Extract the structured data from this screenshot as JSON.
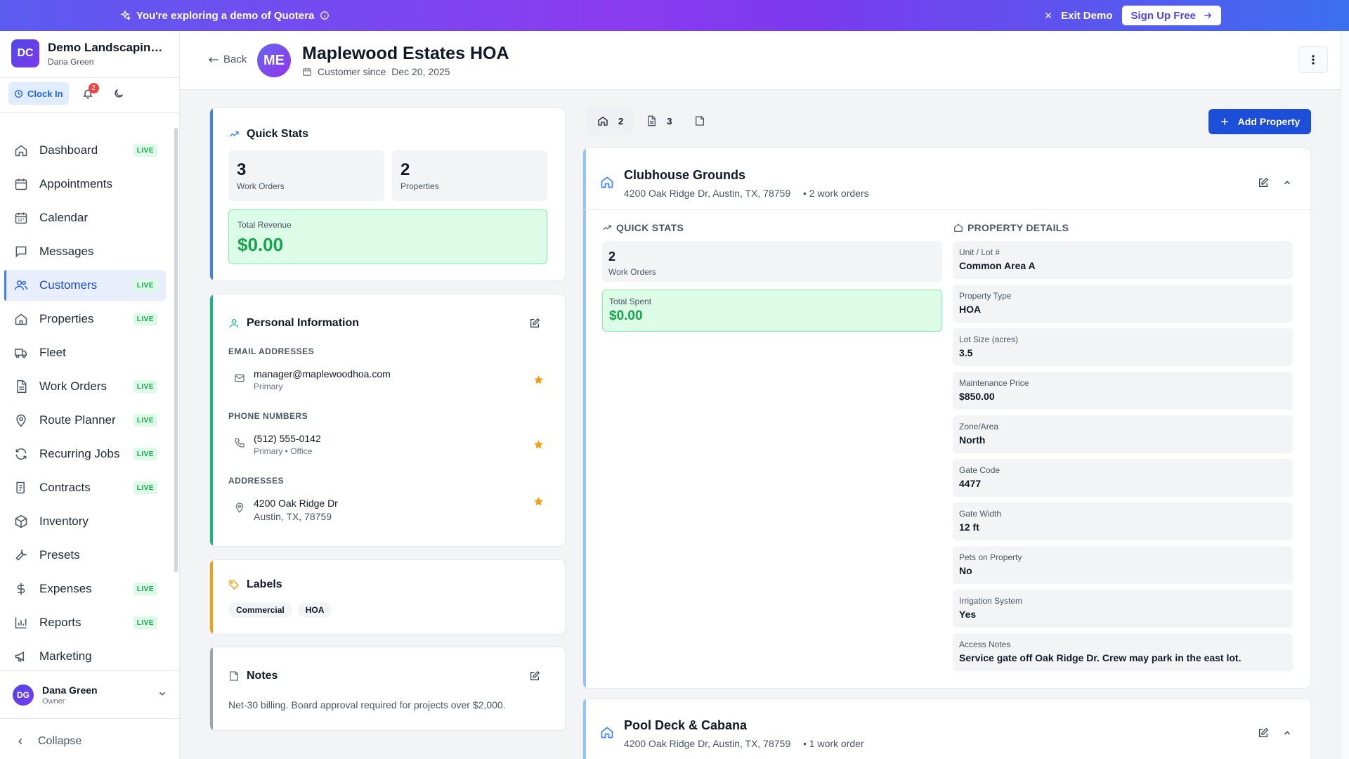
{
  "banner": {
    "message": "You're exploring a demo of Quotera",
    "exit_label": "Exit Demo",
    "signup_label": "Sign Up Free"
  },
  "org": {
    "initials": "DC",
    "name": "Demo Landscaping Co.",
    "user": "Dana Green"
  },
  "toolbar": {
    "clock_in_label": "Clock In",
    "notification_count": "2"
  },
  "nav": {
    "items": [
      {
        "label": "Dashboard",
        "live": "LIVE"
      },
      {
        "label": "Appointments",
        "live": ""
      },
      {
        "label": "Calendar",
        "live": ""
      },
      {
        "label": "Messages",
        "live": ""
      },
      {
        "label": "Customers",
        "live": "LIVE"
      },
      {
        "label": "Properties",
        "live": "LIVE"
      },
      {
        "label": "Fleet",
        "live": ""
      },
      {
        "label": "Work Orders",
        "live": "LIVE"
      },
      {
        "label": "Route Planner",
        "live": "LIVE"
      },
      {
        "label": "Recurring Jobs",
        "live": "LIVE"
      },
      {
        "label": "Contracts",
        "live": "LIVE"
      },
      {
        "label": "Inventory",
        "live": ""
      },
      {
        "label": "Presets",
        "live": ""
      },
      {
        "label": "Expenses",
        "live": "LIVE"
      },
      {
        "label": "Reports",
        "live": "LIVE"
      },
      {
        "label": "Marketing",
        "live": ""
      }
    ],
    "active": "Customers"
  },
  "user_footer": {
    "initials": "DG",
    "name": "Dana Green",
    "role": "Owner",
    "collapse_label": "Collapse"
  },
  "header": {
    "back_label": "Back",
    "initials": "ME",
    "customer_name": "Maplewood Estates HOA",
    "since_label": "Customer since",
    "since_date": "Dec 20, 2025"
  },
  "quick_stats": {
    "title": "Quick Stats",
    "work_orders": "3",
    "work_orders_label": "Work Orders",
    "properties": "2",
    "properties_label": "Properties",
    "revenue_label": "Total Revenue",
    "revenue": "$0.00"
  },
  "personal": {
    "title": "Personal Information",
    "email_heading": "EMAIL ADDRESSES",
    "email": "manager@maplewoodhoa.com",
    "email_sub": "Primary",
    "phone_heading": "PHONE NUMBERS",
    "phone": "(512) 555-0142",
    "phone_sub": "Primary • Office",
    "address_heading": "ADDRESSES",
    "address_line1": "4200 Oak Ridge Dr",
    "address_line2": "Austin, TX, 78759"
  },
  "labels": {
    "title": "Labels",
    "chips": [
      "Commercial",
      "HOA"
    ]
  },
  "notes": {
    "title": "Notes",
    "text": "Net-30 billing. Board approval required for projects over $2,000."
  },
  "tabs": [
    {
      "icon": "home-icon",
      "count": "2"
    },
    {
      "icon": "document-icon",
      "count": "3"
    },
    {
      "icon": "note-icon",
      "count": ""
    }
  ],
  "add_property_label": "Add Property",
  "property1": {
    "name": "Clubhouse Grounds",
    "address": "4200 Oak Ridge Dr, Austin, TX, 78759",
    "work_orders_note": "• 2 work orders",
    "quick_stats_heading": "QUICK STATS",
    "work_orders": "2",
    "work_orders_label": "Work Orders",
    "spent_label": "Total Spent",
    "spent": "$0.00",
    "details_heading": "PROPERTY DETAILS",
    "details": [
      {
        "label": "Unit / Lot #",
        "value": "Common Area A"
      },
      {
        "label": "Property Type",
        "value": "HOA"
      },
      {
        "label": "Lot Size (acres)",
        "value": "3.5"
      },
      {
        "label": "Maintenance Price",
        "value": "$850.00"
      },
      {
        "label": "Zone/Area",
        "value": "North"
      },
      {
        "label": "Gate Code",
        "value": "4477"
      },
      {
        "label": "Gate Width",
        "value": "12 ft"
      },
      {
        "label": "Pets on Property",
        "value": "No"
      },
      {
        "label": "Irrigation System",
        "value": "Yes"
      },
      {
        "label": "Access Notes",
        "value": "Service gate off Oak Ridge Dr. Crew may park in the east lot."
      }
    ]
  },
  "property2": {
    "name": "Pool Deck & Cabana",
    "address": "4200 Oak Ridge Dr, Austin, TX, 78759",
    "work_orders_note": "• 1 work order"
  },
  "colors": {
    "primary": "#1d4ed8",
    "success": "#16a34a",
    "live_bg": "#dcfce7",
    "star": "#f59e0b",
    "accent_stats": "#3b82f6",
    "accent_personal": "#10b981",
    "accent_labels": "#f59e0b",
    "accent_notes": "#9ca3af"
  }
}
